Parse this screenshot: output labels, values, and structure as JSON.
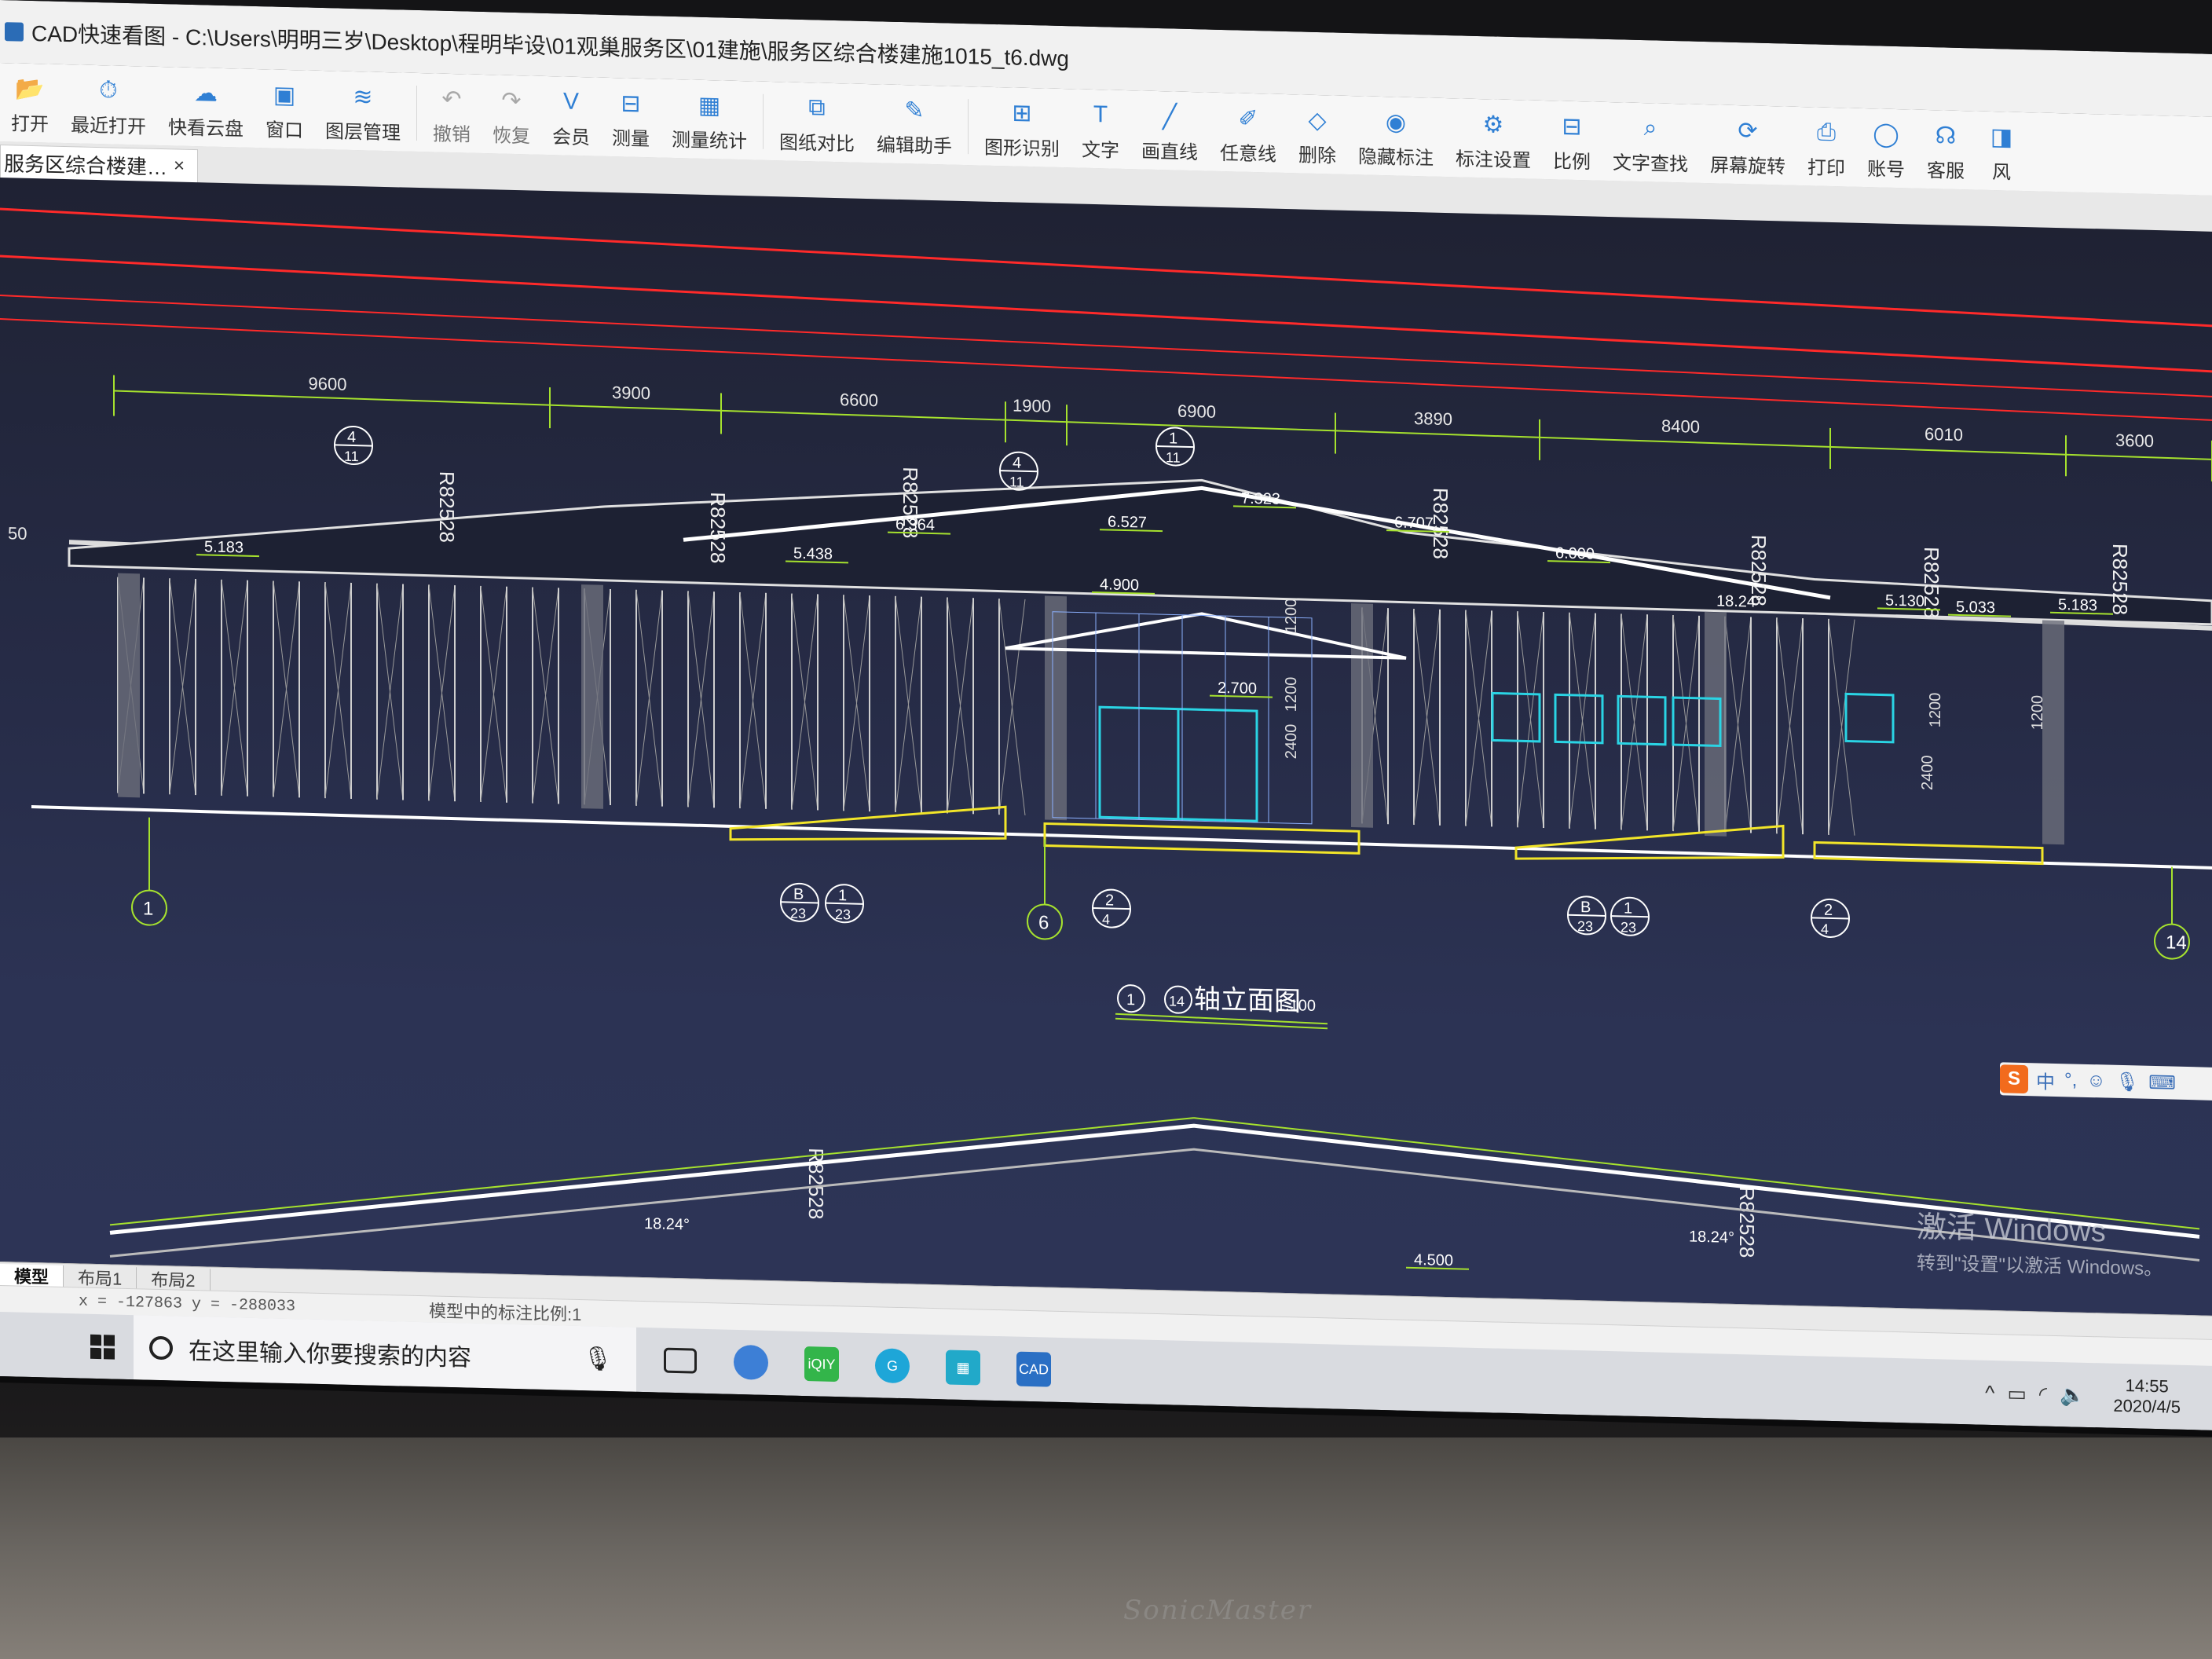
{
  "window": {
    "title": "CAD快速看图 - C:\\Users\\明明三岁\\Desktop\\程明毕设\\01观巢服务区\\01建施\\服务区综合楼建施1015_t6.dwg"
  },
  "toolbar": {
    "items": [
      {
        "label": "打开",
        "icon": "open-folder-icon"
      },
      {
        "label": "最近打开",
        "icon": "clock-icon"
      },
      {
        "label": "快看云盘",
        "icon": "cloud-icon"
      },
      {
        "label": "窗口",
        "icon": "window-icon"
      },
      {
        "label": "图层管理",
        "icon": "layers-icon"
      },
      {
        "label": "撤销",
        "icon": "undo-icon"
      },
      {
        "label": "恢复",
        "icon": "redo-icon"
      },
      {
        "label": "会员",
        "icon": "vip-icon"
      },
      {
        "label": "测量",
        "icon": "ruler-icon"
      },
      {
        "label": "测量统计",
        "icon": "measure-stats-icon"
      },
      {
        "label": "图纸对比",
        "icon": "compare-icon"
      },
      {
        "label": "编辑助手",
        "icon": "edit-assistant-icon"
      },
      {
        "label": "图形识别",
        "icon": "shape-recognition-icon"
      },
      {
        "label": "文字",
        "icon": "text-icon"
      },
      {
        "label": "画直线",
        "icon": "line-icon"
      },
      {
        "label": "任意线",
        "icon": "freehand-icon"
      },
      {
        "label": "删除",
        "icon": "eraser-icon"
      },
      {
        "label": "隐藏标注",
        "icon": "hide-annotation-icon"
      },
      {
        "label": "标注设置",
        "icon": "annotation-settings-icon"
      },
      {
        "label": "比例",
        "icon": "scale-icon"
      },
      {
        "label": "文字查找",
        "icon": "text-search-icon"
      },
      {
        "label": "屏幕旋转",
        "icon": "rotate-screen-icon"
      },
      {
        "label": "打印",
        "icon": "printer-icon"
      },
      {
        "label": "账号",
        "icon": "account-icon"
      },
      {
        "label": "客服",
        "icon": "headset-icon"
      },
      {
        "label": "风",
        "icon": "style-icon"
      }
    ]
  },
  "document_tab": {
    "label": "服务区综合楼建…",
    "close": "×"
  },
  "drawing": {
    "title": "①-⑭轴立面图",
    "scale": "1:100",
    "title_num_a": "1",
    "title_num_b": "14",
    "top_dims": [
      "9600",
      "3900",
      "6600",
      "1900",
      "6900",
      "3890",
      "8400",
      "6010",
      "3600"
    ],
    "radius_labels": [
      "R82528",
      "R82528",
      "R82528",
      "R82528",
      "R82528",
      "R82528",
      "R82528",
      "R82528",
      "R82528"
    ],
    "elevations": [
      "5.183",
      "5.438",
      "6.364",
      "6.527",
      "7.323",
      "6.707",
      "6.000",
      "5.130",
      "5.033",
      "5.183",
      "4.900",
      "2.700",
      "4.500"
    ],
    "angles": [
      "18.24°",
      "18.24°",
      "18.24°"
    ],
    "vert_dims": [
      "1200",
      "1200",
      "2400",
      "1200",
      "2400",
      "1200"
    ],
    "axis_bubbles": [
      "1",
      "6",
      "14"
    ],
    "detail_bubbles": [
      {
        "top": "B",
        "bottom": "23"
      },
      {
        "top": "1",
        "bottom": "23"
      },
      {
        "top": "2",
        "bottom": "4"
      },
      {
        "top": "B",
        "bottom": "23"
      },
      {
        "top": "1",
        "bottom": "23"
      },
      {
        "top": "2",
        "bottom": "4"
      },
      {
        "top": "4",
        "bottom": "11"
      },
      {
        "top": "4",
        "bottom": "11"
      },
      {
        "top": "1",
        "bottom": "11"
      }
    ],
    "left_edge": "50"
  },
  "watermark": {
    "line1": "激活 Windows",
    "line2": "转到\"设置\"以激活 Windows。"
  },
  "ime": {
    "lang": "中",
    "symbols": "°,"
  },
  "layout_tabs": [
    "模型",
    "布局1",
    "布局2"
  ],
  "status": {
    "coords": "x = -127863 y = -288033",
    "scale_text": "模型中的标注比例:1"
  },
  "taskbar": {
    "search_placeholder": "在这里输入你要搜索的内容",
    "time": "14:55",
    "date": "2020/4/5"
  },
  "brand": "SonicMaster",
  "colors": {
    "canvas": "#262b46",
    "dim_line": "#a6e22e",
    "building": "#e8e8e8",
    "red_line": "#ff2a2a",
    "yellow": "#f2e529",
    "cyan": "#2ad4e4"
  }
}
